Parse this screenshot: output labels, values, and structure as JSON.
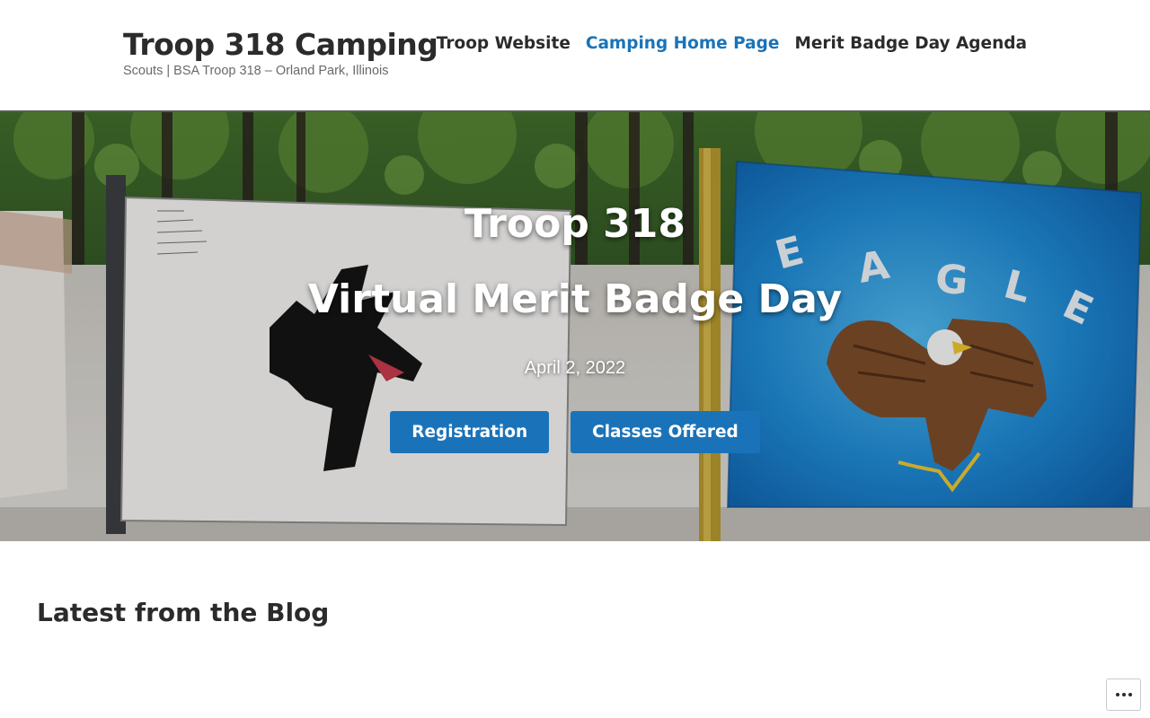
{
  "header": {
    "site_title": "Troop 318 Camping",
    "tagline": "Scouts | BSA Troop 318 – Orland Park, Illinois"
  },
  "nav": {
    "items": [
      {
        "label": "Troop Website",
        "current": false
      },
      {
        "label": "Camping Home Page",
        "current": true
      },
      {
        "label": "Merit Badge Day Agenda",
        "current": false
      }
    ]
  },
  "hero": {
    "title_line1": "Troop 318",
    "title_line2": "Virtual Merit Badge Day",
    "date": "April 2, 2022",
    "buttons": [
      {
        "label": "Registration"
      },
      {
        "label": "Classes Offered"
      }
    ],
    "flag_letters": [
      "E",
      "A",
      "G",
      "L",
      "E"
    ]
  },
  "main": {
    "blog_heading": "Latest from the Blog"
  },
  "icons": {
    "more": "more-horizontal-icon"
  },
  "colors": {
    "accent": "#1a73b8",
    "text": "#2b2b2b",
    "tagline": "#6a6a6a"
  }
}
